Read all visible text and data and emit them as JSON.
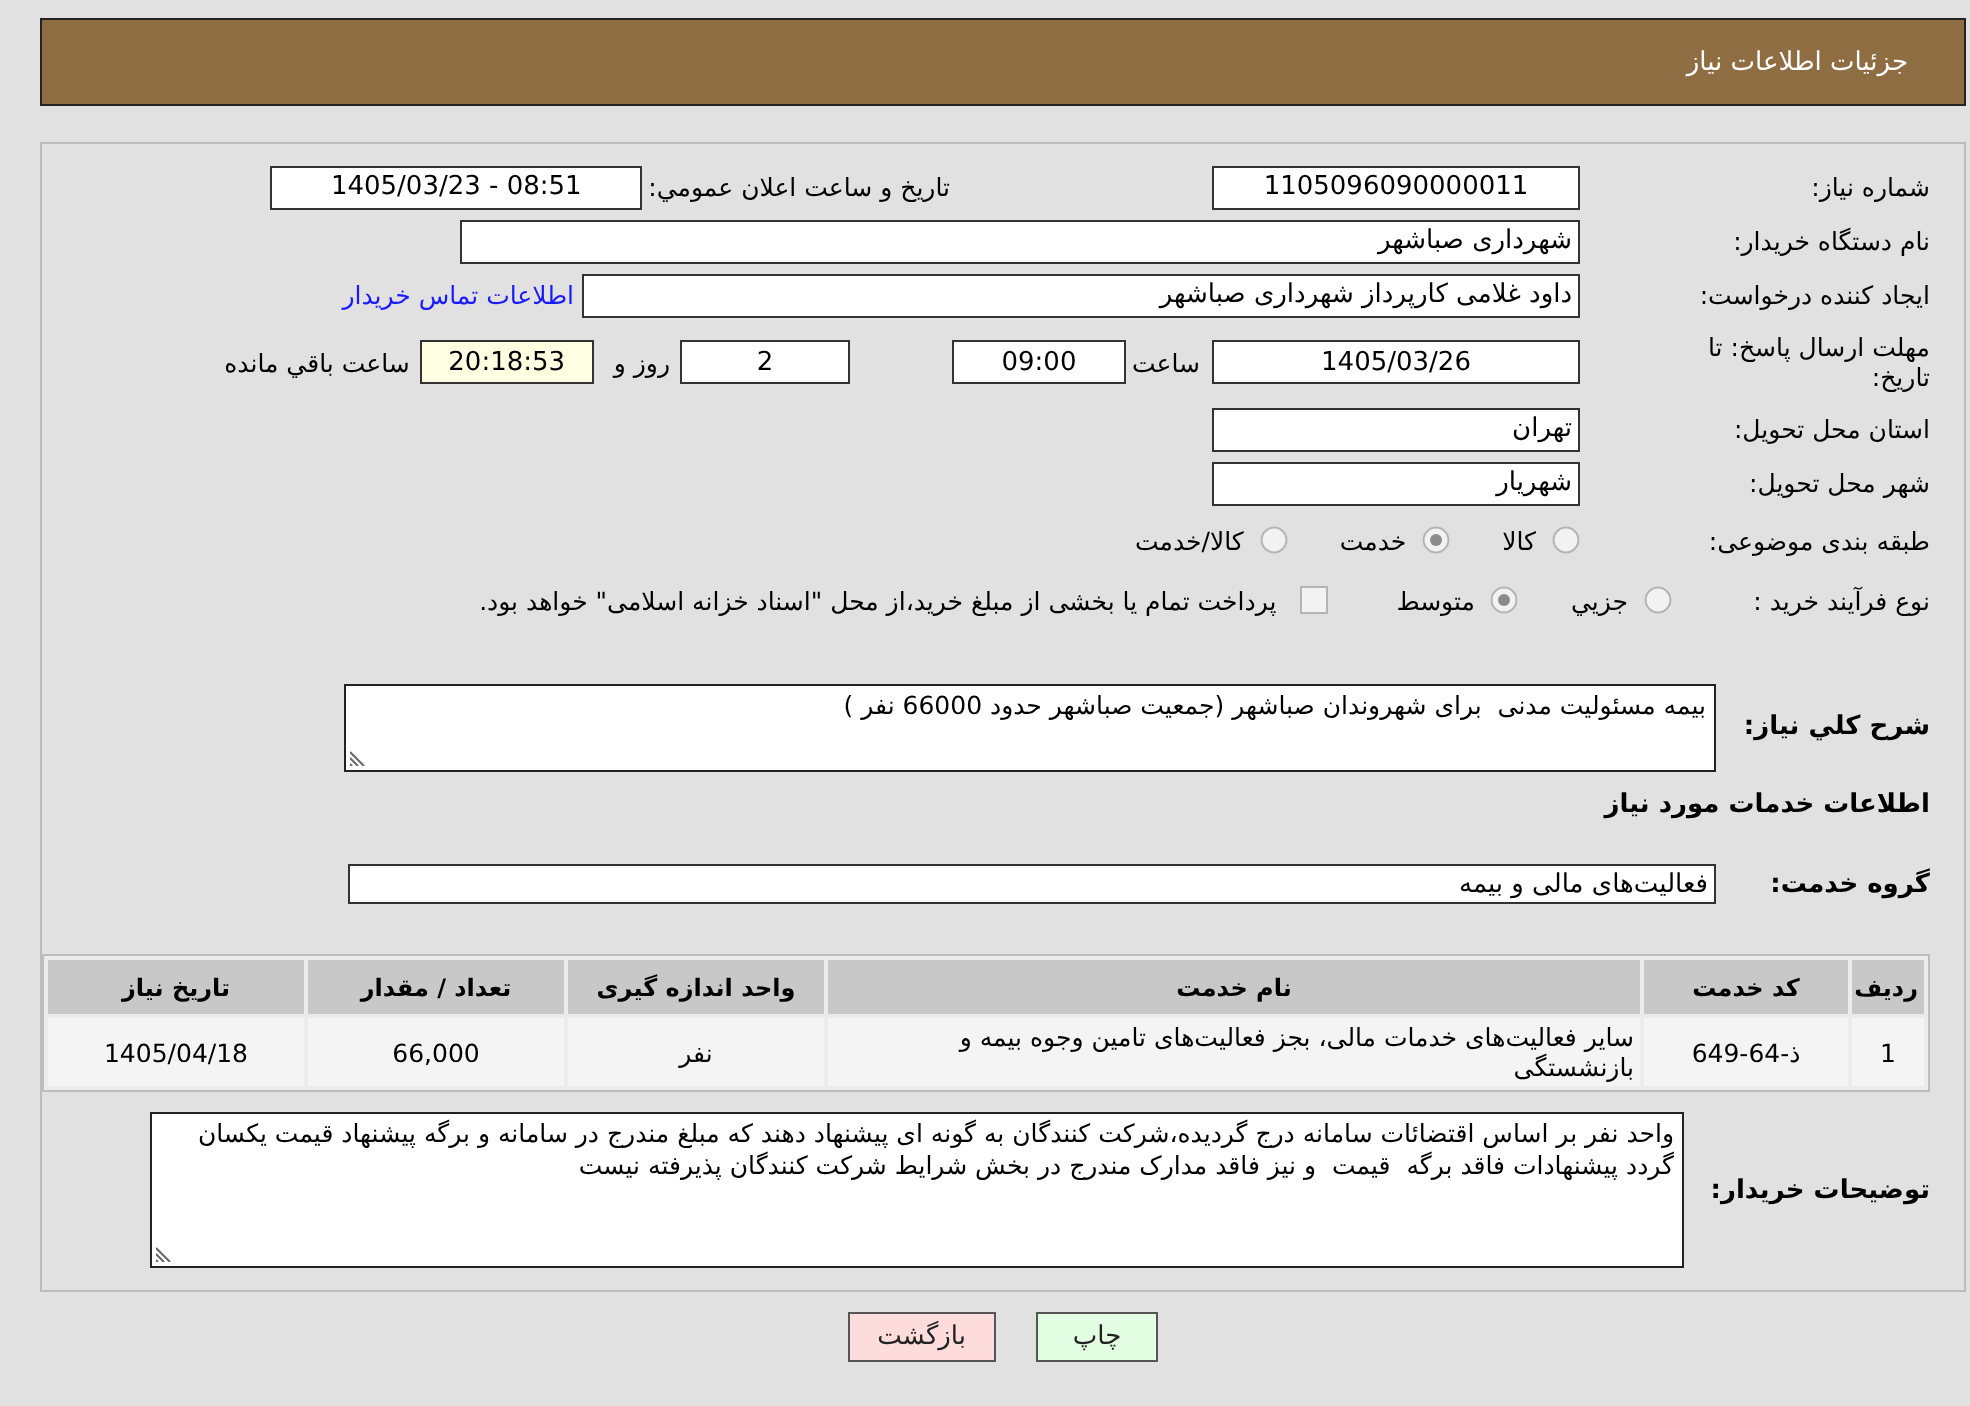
{
  "header": {
    "title": "جزئیات اطلاعات نیاز"
  },
  "need_number": {
    "label": "شماره نیاز:",
    "value": "1105096090000011"
  },
  "announcement": {
    "label": "تاریخ و ساعت اعلان عمومي:",
    "value": "1405/03/23 - 08:51"
  },
  "buyer_org": {
    "label": "نام دستگاه خريدار:",
    "value": "شهرداری صباشهر"
  },
  "requester": {
    "label": "ايجاد کننده درخواست:",
    "value": "داود غلامی کارپرداز شهرداری صباشهر",
    "contact_link": "اطلاعات تماس خريدار"
  },
  "deadline": {
    "label": "مهلت ارسال پاسخ: تا تاریخ:",
    "date": "1405/03/26",
    "time_label": "ساعت",
    "time": "09:00",
    "days": "2",
    "days_label": "روز و",
    "remaining": "20:18:53",
    "remaining_label": "ساعت باقي مانده"
  },
  "province": {
    "label": "استان محل تحويل:",
    "value": "تهران"
  },
  "city": {
    "label": "شهر محل تحويل:",
    "value": "شهريار"
  },
  "category": {
    "label": "طبقه بندی موضوعی:",
    "options": [
      {
        "label": "كالا",
        "selected": false
      },
      {
        "label": "خدمت",
        "selected": true
      },
      {
        "label": "كالا/خدمت",
        "selected": false
      }
    ]
  },
  "process": {
    "label": "نوع فرآيند خريد :",
    "options": [
      {
        "label": "جزيي",
        "selected": false
      },
      {
        "label": "متوسط",
        "selected": true
      }
    ],
    "treasury": {
      "checked": false,
      "text": "پرداخت تمام يا بخشی از مبلغ خريد،از محل \"اسناد خزانه اسلامی\" خواهد بود."
    }
  },
  "description": {
    "label": "شرح کلي نياز:",
    "value": "بيمه مسئوليت مدنی  برای شهروندان صباشهر (جمعيت صباشهر حدود 66000 نفر )"
  },
  "services_heading": "اطلاعات خدمات مورد نياز",
  "service_group": {
    "label": "گروه خدمت:",
    "value": "فعاليت‌هاى مالی و بيمه"
  },
  "table": {
    "columns": [
      "رديف",
      "کد خدمت",
      "نام خدمت",
      "واحد اندازه گيری",
      "تعداد / مقدار",
      "تاريخ نياز"
    ],
    "rows": [
      [
        "1",
        "ذ-64-649",
        "ساير فعاليت‌هاى خدمات مالی، بجز فعاليت‌هاى تامين وجوه بيمه و بازنشستگی",
        "نفر",
        "66,000",
        "1405/04/18"
      ]
    ]
  },
  "buyer_notes": {
    "label": "توضيحات خريدار:",
    "value": "واحد نفر بر اساس اقتضائات سامانه درج گرديده،شرکت کنندگان به گونه ای پيشنهاد دهند که مبلغ مندرج در سامانه و برگه پيشنهاد قيمت يکسان گردد پيشنهادات فاقد برگه  قيمت  و نيز فاقد مدارک مندرج در بخش شرايط شرکت کنندگان پذيرفته نيست"
  },
  "buttons": [
    {
      "label": "چاپ",
      "kind": "print"
    },
    {
      "label": "بازگشت",
      "kind": "back"
    }
  ]
}
